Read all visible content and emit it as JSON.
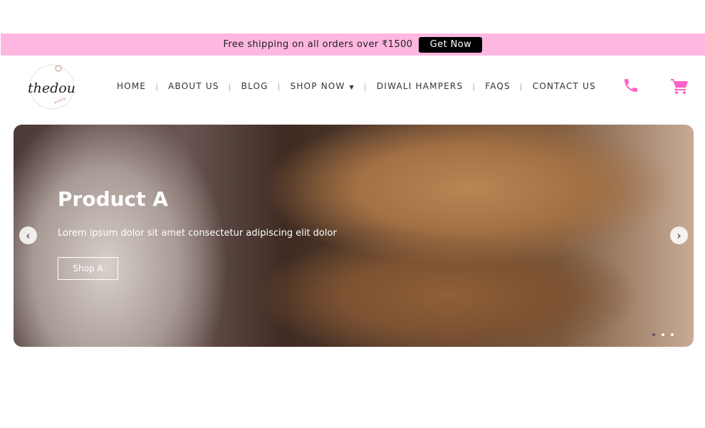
{
  "promo": {
    "text": "Free shipping on all orders over ₹1500",
    "button": "Get Now"
  },
  "logo": {
    "text": "thedou"
  },
  "nav": {
    "items": [
      {
        "label": "HOME"
      },
      {
        "label": "ABOUT US"
      },
      {
        "label": "BLOG"
      },
      {
        "label": "SHOP NOW",
        "dropdown": true
      },
      {
        "label": "DIWALI HAMPERS"
      },
      {
        "label": "FAQS"
      },
      {
        "label": "CONTACT US"
      }
    ]
  },
  "icons": {
    "phone": "phone-icon",
    "cart": "cart-icon",
    "accent": "#ff5fc8"
  },
  "hero": {
    "title": "Product A",
    "subtitle": "Lorem ipsum dolor sit amet consectetur adipiscing elit dolor",
    "button": "Shop A",
    "slides": 3,
    "active_slide": 1
  }
}
